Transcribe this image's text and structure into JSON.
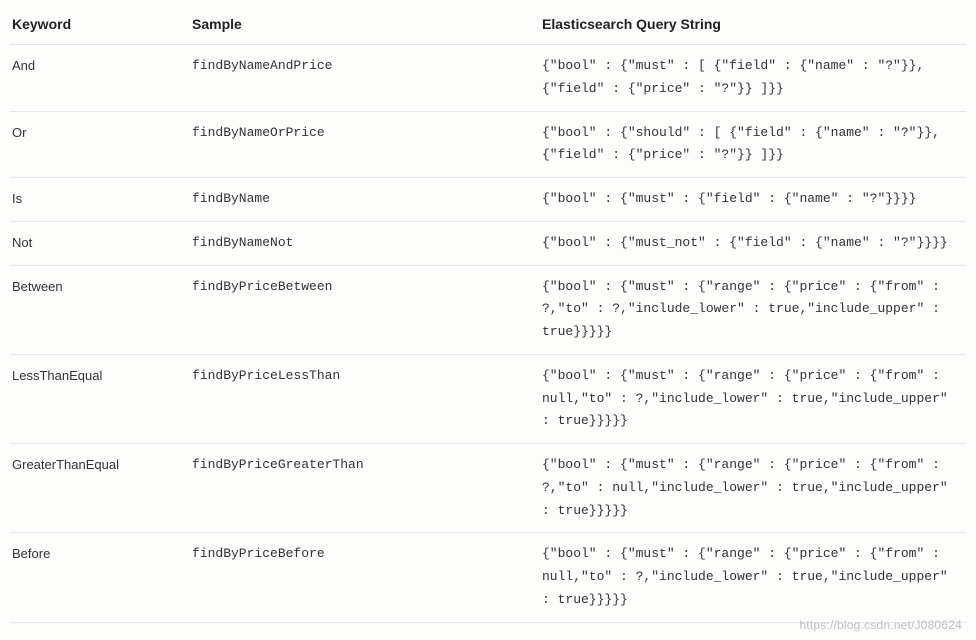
{
  "headers": {
    "keyword": "Keyword",
    "sample": "Sample",
    "query": "Elasticsearch Query String"
  },
  "rows": [
    {
      "keyword": "And",
      "sample": "findByNameAndPrice",
      "query": "{\"bool\" : {\"must\" : [ {\"field\" : {\"name\" : \"?\"}}, {\"field\" : {\"price\" : \"?\"}} ]}}"
    },
    {
      "keyword": "Or",
      "sample": "findByNameOrPrice",
      "query": "{\"bool\" : {\"should\" : [ {\"field\" : {\"name\" : \"?\"}}, {\"field\" : {\"price\" : \"?\"}} ]}}"
    },
    {
      "keyword": "Is",
      "sample": "findByName",
      "query": "{\"bool\" : {\"must\" : {\"field\" : {\"name\" : \"?\"}}}}"
    },
    {
      "keyword": "Not",
      "sample": "findByNameNot",
      "query": "{\"bool\" : {\"must_not\" : {\"field\" : {\"name\" : \"?\"}}}}"
    },
    {
      "keyword": "Between",
      "sample": "findByPriceBetween",
      "query": "{\"bool\" : {\"must\" : {\"range\" : {\"price\" : {\"from\" : ?,\"to\" : ?,\"include_lower\" : true,\"include_upper\" : true}}}}}"
    },
    {
      "keyword": "LessThanEqual",
      "sample": "findByPriceLessThan",
      "query": "{\"bool\" : {\"must\" : {\"range\" : {\"price\" : {\"from\" : null,\"to\" : ?,\"include_lower\" : true,\"include_upper\" : true}}}}}"
    },
    {
      "keyword": "GreaterThanEqual",
      "sample": "findByPriceGreaterThan",
      "query": "{\"bool\" : {\"must\" : {\"range\" : {\"price\" : {\"from\" : ?,\"to\" : null,\"include_lower\" : true,\"include_upper\" : true}}}}}"
    },
    {
      "keyword": "Before",
      "sample": "findByPriceBefore",
      "query": "{\"bool\" : {\"must\" : {\"range\" : {\"price\" : {\"from\" : null,\"to\" : ?,\"include_lower\" : true,\"include_upper\" : true}}}}}"
    }
  ],
  "watermark": "https://blog.csdn.net/J080624"
}
